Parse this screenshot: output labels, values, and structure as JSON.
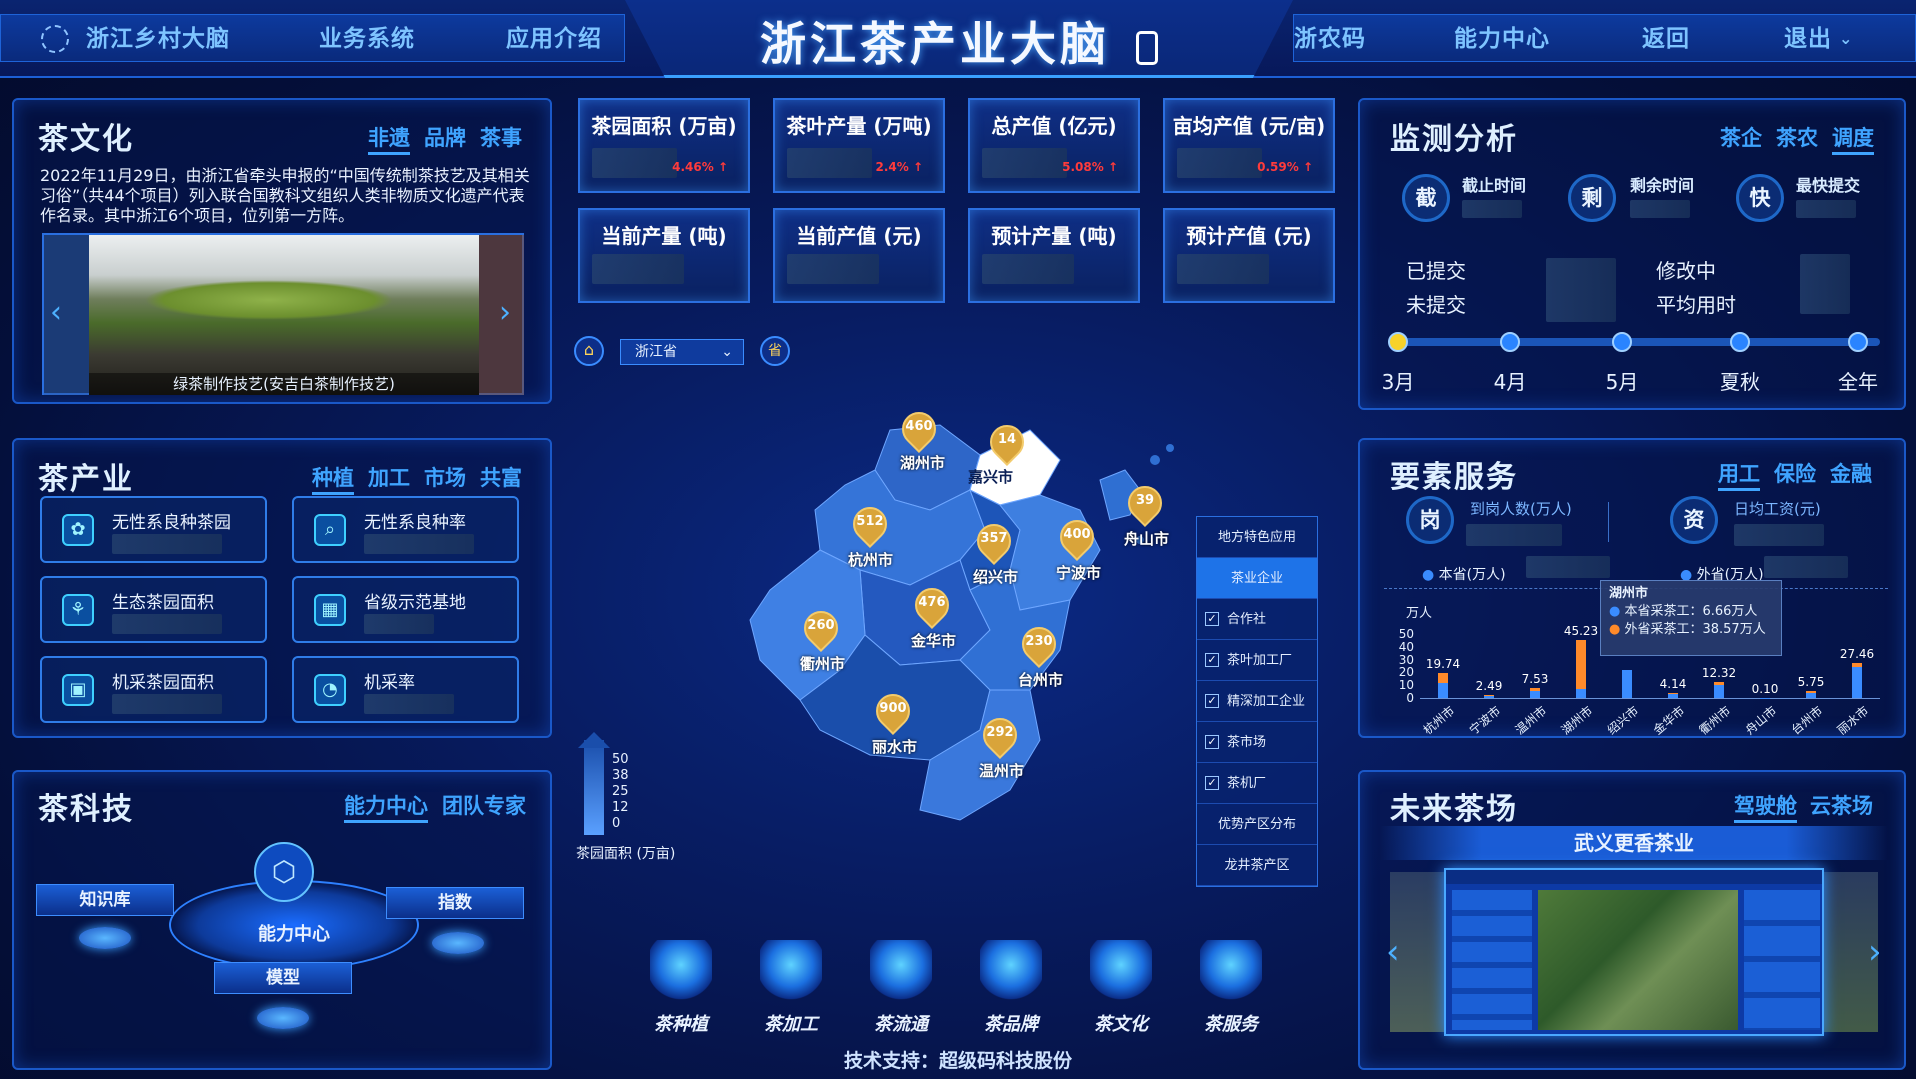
{
  "header": {
    "left_nav": [
      {
        "label": "浙江乡村大脑"
      },
      {
        "label": "业务系统"
      },
      {
        "label": "应用介绍"
      }
    ],
    "title": "浙江茶产业大脑",
    "right_nav": [
      {
        "label": "浙农码"
      },
      {
        "label": "能力中心"
      },
      {
        "label": "返回"
      },
      {
        "label": "退出"
      }
    ]
  },
  "culture": {
    "title": "茶文化",
    "tabs": [
      "非遗",
      "品牌",
      "茶事"
    ],
    "text": "2022年11月29日，由浙江省牵头申报的“中国传统制茶技艺及其相关习俗”（共44个项目）列入联合国教科文组织人类非物质文化遗产代表作名录。其中浙江6个项目，位列第一方阵。",
    "caption": "绿茶制作技艺(安吉白茶制作技艺)"
  },
  "industry": {
    "title": "茶产业",
    "tabs": [
      "种植",
      "加工",
      "市场",
      "共富"
    ],
    "cards": [
      {
        "label": "无性系良种茶园"
      },
      {
        "label": "无性系良种率"
      },
      {
        "label": "生态茶园面积"
      },
      {
        "label": "省级示范基地"
      },
      {
        "label": "机采茶园面积"
      },
      {
        "label": "机采率"
      }
    ]
  },
  "tech": {
    "title": "茶科技",
    "tabs": [
      "能力中心",
      "团队专家"
    ],
    "center": "能力中心",
    "nodes": [
      {
        "label": "知识库"
      },
      {
        "label": "指数"
      },
      {
        "label": "模型"
      }
    ]
  },
  "kpis": [
    {
      "label": "茶园面积 (万亩)",
      "delta": "4.46%"
    },
    {
      "label": "茶叶产量 (万吨)",
      "delta": "2.4%"
    },
    {
      "label": "总产值 (亿元)",
      "delta": "5.08%"
    },
    {
      "label": "亩均产值 (元/亩)",
      "delta": "0.59%"
    },
    {
      "label": "当前产量 (吨)"
    },
    {
      "label": "当前产值 (元)"
    },
    {
      "label": "预计产量 (吨)"
    },
    {
      "label": "预计产值 (元)"
    }
  ],
  "map": {
    "select": "浙江省",
    "province_badge": "省",
    "legend": {
      "ticks": [
        "50",
        "38",
        "25",
        "12",
        "0"
      ],
      "label": "茶园面积 (万亩)"
    },
    "cities": [
      {
        "name": "湖州市",
        "value": "460"
      },
      {
        "name": "嘉兴市",
        "value": "14"
      },
      {
        "name": "舟山市",
        "value": "39"
      },
      {
        "name": "杭州市",
        "value": "512"
      },
      {
        "name": "绍兴市",
        "value": "357"
      },
      {
        "name": "宁波市",
        "value": "400"
      },
      {
        "name": "金华市",
        "value": "476"
      },
      {
        "name": "衢州市",
        "value": "260"
      },
      {
        "name": "台州市",
        "value": "230"
      },
      {
        "name": "丽水市",
        "value": "900"
      },
      {
        "name": "温州市",
        "value": "292"
      }
    ],
    "side_list": [
      {
        "label": "地方特色应用"
      },
      {
        "label": "茶业企业"
      },
      {
        "label": "合作社",
        "check": "✓"
      },
      {
        "label": "茶叶加工厂",
        "check": "✓"
      },
      {
        "label": "精深加工企业",
        "check": "✓"
      },
      {
        "label": "茶市场",
        "check": "✓"
      },
      {
        "label": "茶机厂",
        "check": "✓"
      },
      {
        "label": "优势产区分布"
      },
      {
        "label": "龙井茶产区"
      }
    ]
  },
  "bottom_nav": [
    {
      "label": "茶种植"
    },
    {
      "label": "茶加工"
    },
    {
      "label": "茶流通"
    },
    {
      "label": "茶品牌"
    },
    {
      "label": "茶文化"
    },
    {
      "label": "茶服务"
    }
  ],
  "footer": "技术支持：超级码科技股份",
  "monitor": {
    "title": "监测分析",
    "tabs": [
      "茶企",
      "茶农",
      "调度"
    ],
    "circles": [
      {
        "char": "截",
        "label": "截止时间"
      },
      {
        "char": "剩",
        "label": "剩余时间"
      },
      {
        "char": "快",
        "label": "最快提交"
      }
    ],
    "stats": [
      "已提交",
      "未提交",
      "修改中",
      "平均用时"
    ],
    "timeline": [
      "3月",
      "4月",
      "5月",
      "夏秋",
      "全年"
    ]
  },
  "factor": {
    "title": "要素服务",
    "tabs": [
      "用工",
      "保险",
      "金融"
    ],
    "circles": [
      {
        "char": "岗",
        "label": "到岗人数(万人)"
      },
      {
        "char": "资",
        "label": "日均工资(元)"
      }
    ],
    "legend": [
      "本省(万人)",
      "外省(万人)"
    ],
    "tooltip": {
      "title": "湖州市",
      "line1": "本省采茶工：6.66万人",
      "line2": "外省采茶工：38.57万人"
    }
  },
  "future": {
    "title": "未来茶场",
    "tabs": [
      "驾驶舱",
      "云茶场"
    ],
    "banner": "武义更香茶业"
  },
  "chart_data": {
    "type": "bar",
    "ylabel": "万人",
    "ylim": [
      0,
      50
    ],
    "yticks": [
      "50",
      "40",
      "30",
      "20",
      "10",
      "0"
    ],
    "categories": [
      "杭州市",
      "宁波市",
      "温州市",
      "湖州市",
      "绍兴市",
      "金华市",
      "衢州市",
      "舟山市",
      "台州市",
      "丽水市"
    ],
    "value_labels": [
      "19.74",
      "2.49",
      "7.53",
      "45.23",
      "",
      "4.14",
      "12.32",
      "0.10",
      "5.75",
      "27.46"
    ],
    "series": [
      {
        "name": "本省",
        "color": "#3a8cff",
        "values": [
          12,
          1.6,
          5.5,
          6.66,
          22,
          3,
          10,
          0.1,
          4,
          24
        ]
      },
      {
        "name": "外省",
        "color": "#ff8a2a",
        "values": [
          7.74,
          0.89,
          2.03,
          38.57,
          0,
          1.14,
          2.32,
          0,
          1.75,
          3.46
        ]
      }
    ]
  }
}
